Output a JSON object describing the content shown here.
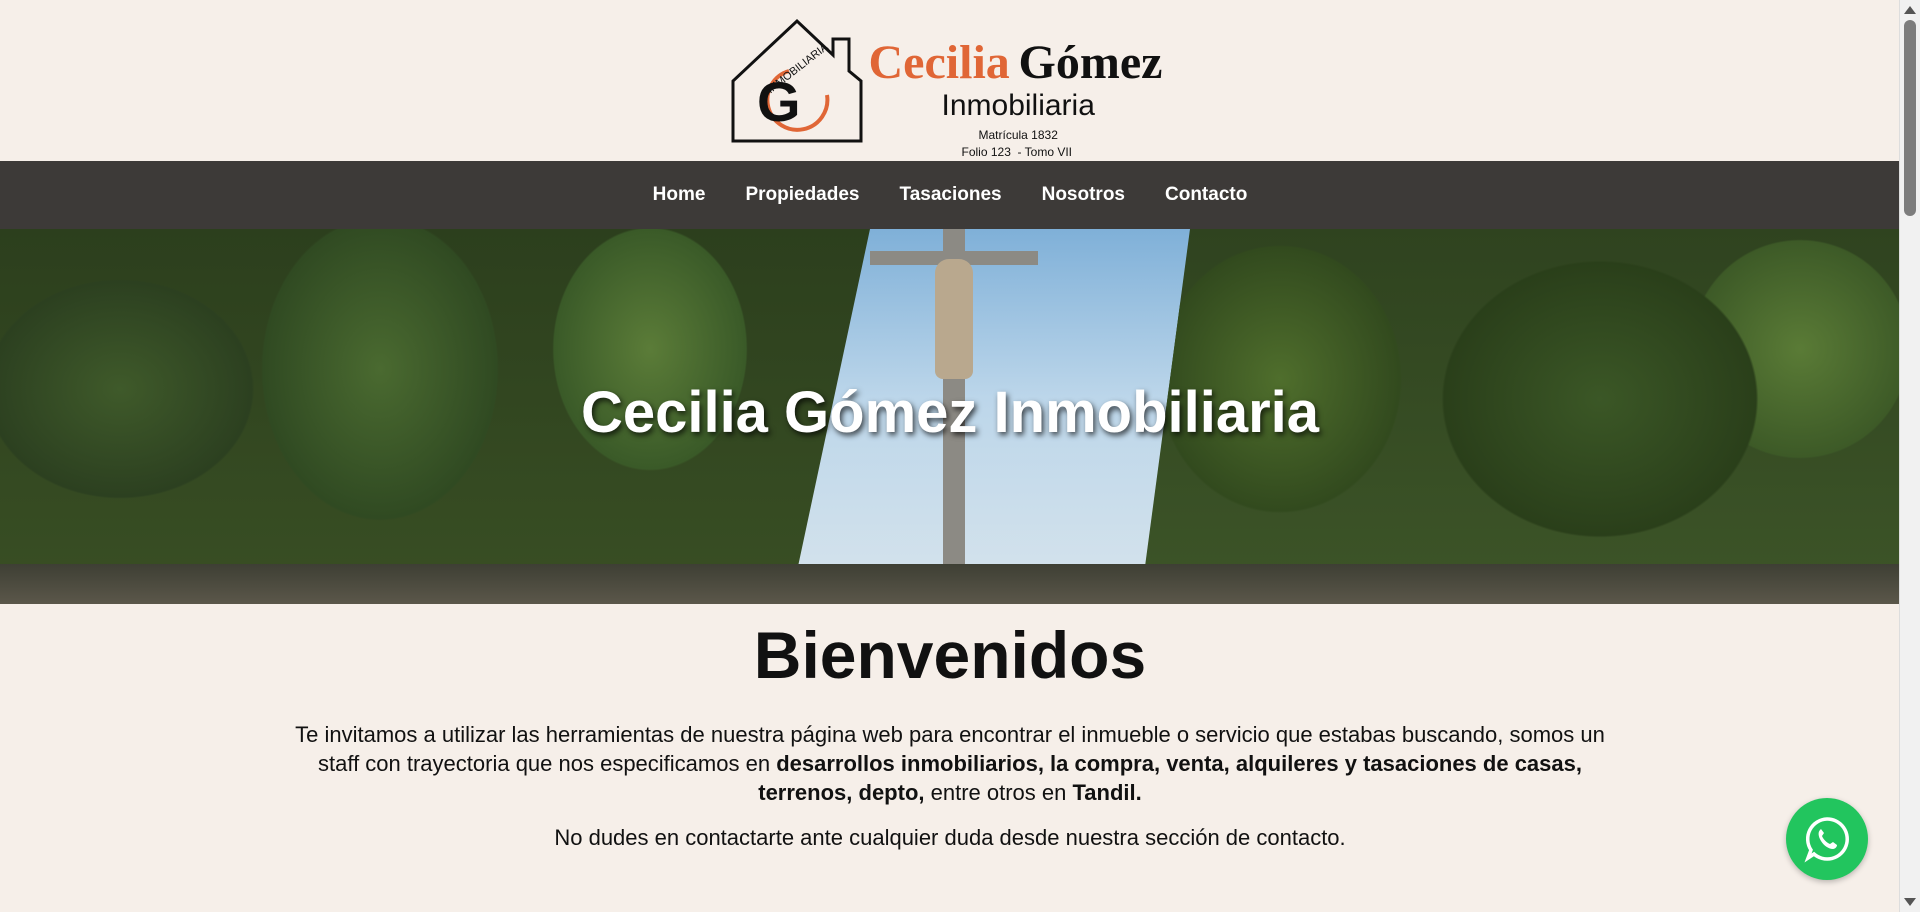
{
  "logo": {
    "emblem_text": "INMOBILIARIA",
    "emblem_letter": "G",
    "brand_first": "Cecilia",
    "brand_last": "Gómez",
    "brand_sub": "Inmobiliaria",
    "matricula": "Matrícula 1832",
    "folio": "Folio 123  - Tomo VII"
  },
  "nav": {
    "items": [
      {
        "label": "Home"
      },
      {
        "label": "Propiedades"
      },
      {
        "label": "Tasaciones"
      },
      {
        "label": "Nosotros"
      },
      {
        "label": "Contacto"
      }
    ]
  },
  "hero": {
    "title": "Cecilia Gómez Inmobiliaria"
  },
  "welcome": {
    "heading": "Bienvenidos",
    "intro_part1": "Te invitamos a utilizar las herramientas de nuestra página web para encontrar el inmueble o servicio que estabas buscando, somos un staff con trayectoria que nos especificamos en ",
    "intro_bold1": "desarrollos inmobiliarios, la compra, venta, alquileres y tasaciones de casas, terrenos, depto,",
    "intro_part2": " entre otros en ",
    "intro_bold2": "Tandil.",
    "contact_note": "No dudes en contactarte ante cualquier duda desde nuestra sección de contacto."
  },
  "colors": {
    "accent_orange": "#e06636",
    "nav_background": "#3d3a38",
    "page_background": "#f6efe9",
    "whatsapp_green": "#22c55e"
  },
  "icons": {
    "whatsapp": "whatsapp-icon"
  }
}
